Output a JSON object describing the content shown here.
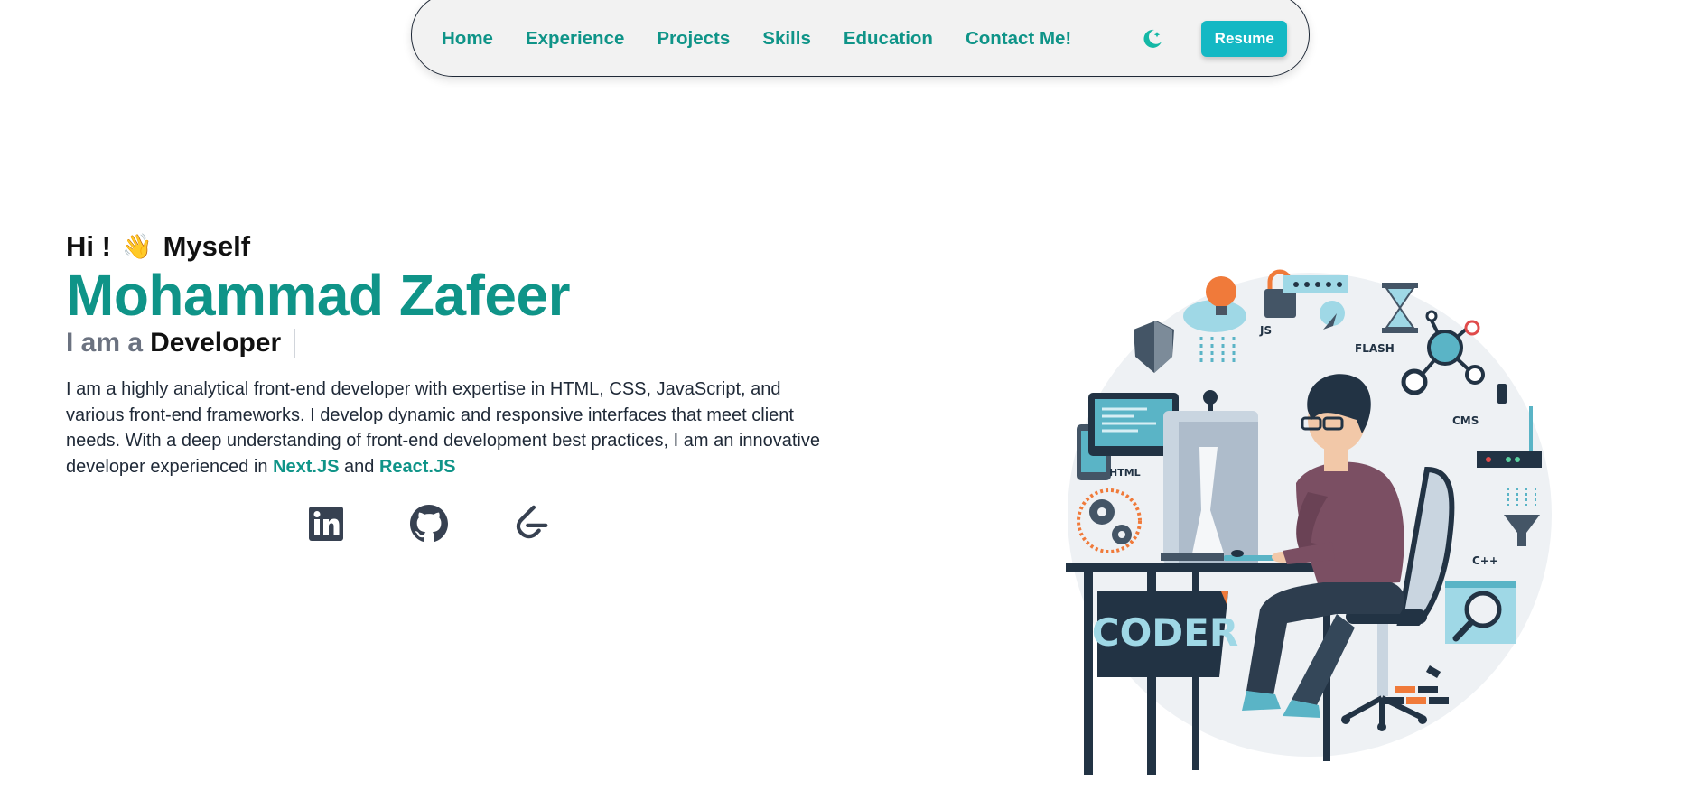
{
  "nav": {
    "links": [
      "Home",
      "Experience",
      "Projects",
      "Skills",
      "Education",
      "Contact Me!"
    ],
    "resume_label": "Resume"
  },
  "hero": {
    "greeting_prefix": "Hi !",
    "greeting_emoji": "👋",
    "greeting_suffix": "Myself",
    "name": "Mohammad Zafeer",
    "role_prefix": "I am a",
    "role_word": "Developer",
    "bio_text": "I am a highly analytical front-end developer with expertise in HTML, CSS, JavaScript, and various front-end frameworks. I develop dynamic and responsive interfaces that meet client needs. With a deep understanding of front-end development best practices, I am an innovative developer experienced in",
    "bio_highlight_1": "Next.JS",
    "bio_and": "and",
    "bio_highlight_2": "React.JS"
  },
  "socials": {
    "icons": [
      "linkedin-icon",
      "github-icon",
      "leetcode-icon"
    ]
  },
  "illustration": {
    "desk_label": "CODER",
    "tags": [
      "JS",
      "FLASH",
      "CMS",
      "HTML",
      "C++"
    ]
  },
  "colors": {
    "accent": "#0f9488",
    "button": "#14b8c4",
    "nav_bg": "#f2f2f2",
    "text": "#1f2937",
    "muted": "#6b7280"
  }
}
